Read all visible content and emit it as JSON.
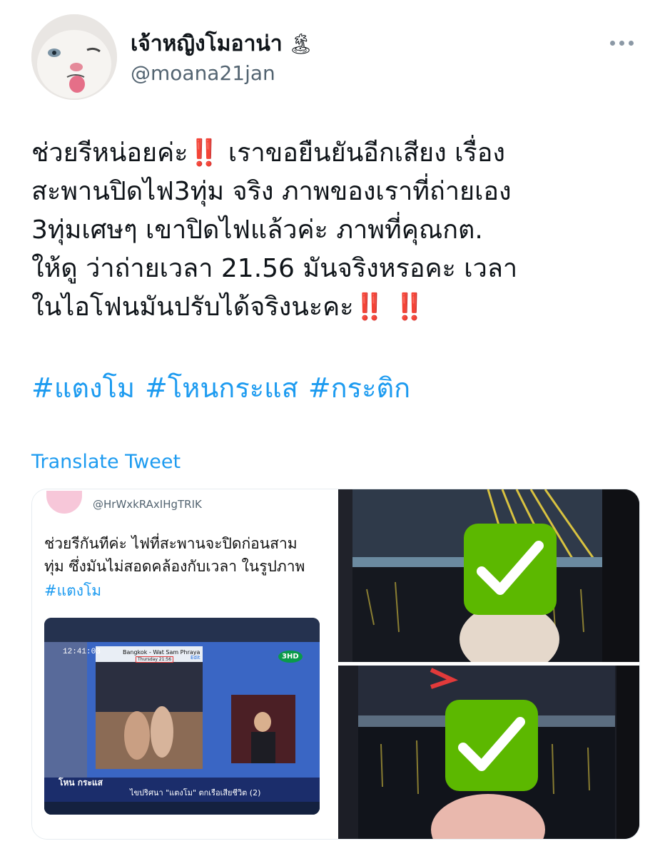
{
  "author": {
    "display_name": "เจ้าหญิงโมอาน่า",
    "emoji": "🏝",
    "handle": "@moana21jan",
    "avatar_icon": "cat-avatar-icon"
  },
  "tweet": {
    "text": "ช่วยรีหน่อยค่ะ‼️ เราขอยืนยันอีกเสียง เรื่อง\nสะพานปิดไฟ3ทุ่ม จริง ภาพของเราที่ถ่ายเอง\n3ทุ่มเศษๆ เขาปิดไฟแล้วค่ะ ภาพที่คุณกต.\nให้ดู ว่าถ่ายเวลา 21.56 มันจริงหรอคะ เวลา\nในไอโฟนมันปรับได้จริงนะคะ‼️ ‼️",
    "hashtags": [
      "#แตงโม",
      "#โหนกระแส",
      "#กระติก"
    ],
    "translate_label": "Translate Tweet"
  },
  "media": {
    "quoted": {
      "handle": "@HrWxkRAxIHgTRIK",
      "text": "ช่วยรีกันทีค่ะ ไฟที่สะพานจะปิดก่อนสาม\nทุ่ม ซึ่งมันไม่สอดคล้องกับเวลา ในรูปภาพ",
      "hashtag": "#แตงโม",
      "tv": {
        "clock": "12:41:03",
        "phone_location": "Bangkok - Wat Sam Phraya",
        "phone_time": "Thursday 21:56",
        "phone_edit": "Edit",
        "channel": "3HD",
        "show_logo": "โหน กระแส",
        "headline": "ไขปริศนา \"แตงโม\" ตกเรือเสียชีวิต (2)"
      }
    },
    "check_icon": "check-mark-icon",
    "colors": {
      "check_green": "#5cb800",
      "accent": "#1d9bf0"
    }
  }
}
